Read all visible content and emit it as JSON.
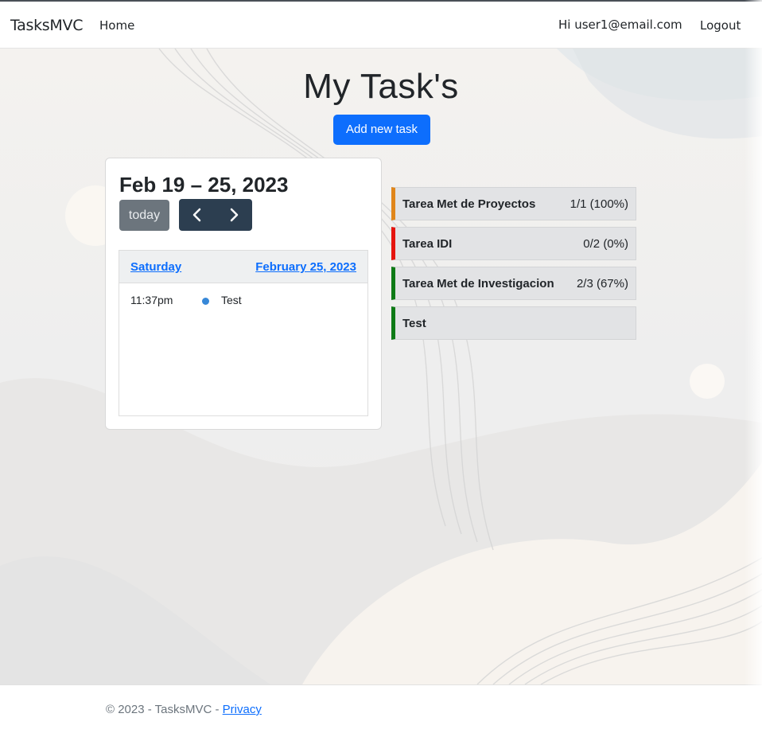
{
  "navbar": {
    "brand": "TasksMVC",
    "home": "Home",
    "greeting": "Hi user1@email.com",
    "logout": "Logout"
  },
  "main": {
    "title": "My Task's",
    "add_button": "Add new task"
  },
  "calendar": {
    "range_title": "Feb 19 – 25, 2023",
    "today_button": "today",
    "prev_icon": "chevron-left-icon",
    "next_icon": "chevron-right-icon",
    "day_name": "Saturday",
    "day_date": "February 25, 2023",
    "events": [
      {
        "time": "11:37pm",
        "title": "Test",
        "dot_color": "#3788d8"
      }
    ]
  },
  "tasks": [
    {
      "name": "Tarea Met de Proyectos",
      "progress": "1/1 (100%)",
      "status_color": "#e0861b"
    },
    {
      "name": "Tarea IDI",
      "progress": "0/2 (0%)",
      "status_color": "#e5150f"
    },
    {
      "name": "Tarea Met de Investigacion",
      "progress": "2/3 (67%)",
      "status_color": "#0e7a16"
    },
    {
      "name": "Test",
      "progress": "",
      "status_color": "#0e7a16"
    }
  ],
  "footer": {
    "copyright": "© 2023 - TasksMVC - ",
    "privacy": "Privacy"
  }
}
